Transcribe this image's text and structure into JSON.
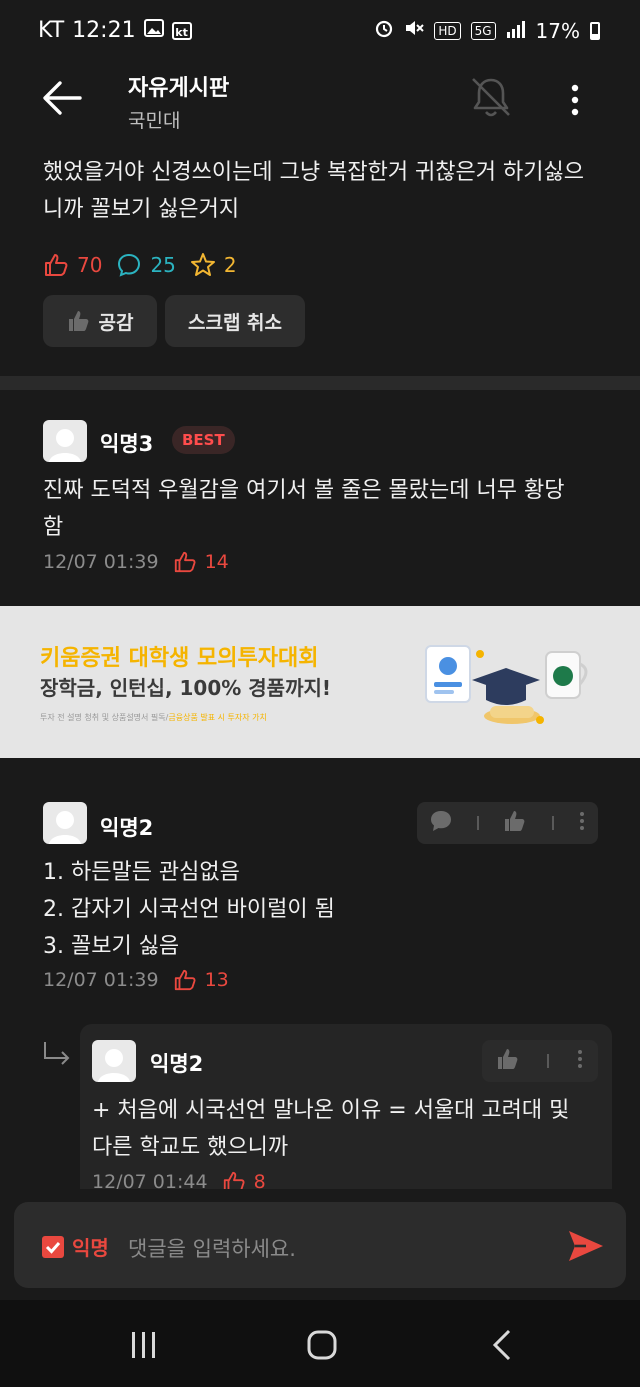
{
  "status": {
    "carrier": "KT",
    "time": "12:21",
    "net_badge": "HD",
    "net_type": "5G",
    "battery": "17%"
  },
  "header": {
    "title": "자유게시판",
    "subtitle": "국민대"
  },
  "post": {
    "body": "했었을거야 신경쓰이는데 그냥 복잡한거 귀찮은거 하기싫으니까 꼴보기 싫은거지",
    "likes": "70",
    "comments": "25",
    "scraps": "2",
    "empathy_label": "공감",
    "scrap_cancel_label": "스크랩 취소"
  },
  "colors": {
    "like": "#e9483f",
    "comment": "#2bb3c0",
    "scrap": "#f2b632",
    "background": "#1a1a1a"
  },
  "comments": [
    {
      "author": "익명3",
      "badge": "BEST",
      "text": "진짜 도덕적 우월감을 여기서 볼 줄은 몰랐는데 너무 황당함",
      "time": "12/07 01:39",
      "likes": "14"
    },
    {
      "author": "익명2",
      "text_lines": [
        "1. 하든말든 관심없음",
        "2. 갑자기 시국선언 바이럴이 됨",
        "3. 꼴보기 싫음"
      ],
      "time": "12/07 01:39",
      "likes": "13"
    }
  ],
  "reply": {
    "author": "익명2",
    "text": "+ 처음에 시국선언 말나온 이유 = 서울대 고려대 및 다른 학교도 했으니까",
    "time": "12/07 01:44",
    "likes": "8"
  },
  "ad": {
    "title": "키움증권 대학생 모의투자대회",
    "subtitle": "장학금, 인턴십, 100% 경품까지!",
    "fine_print": "투자 전 설명 청취 및 상품설명서 필독/",
    "fine_print_highlight": "금융상품 발표 시 투자자 가치"
  },
  "composer": {
    "anon_label": "익명",
    "placeholder": "댓글을 입력하세요."
  }
}
